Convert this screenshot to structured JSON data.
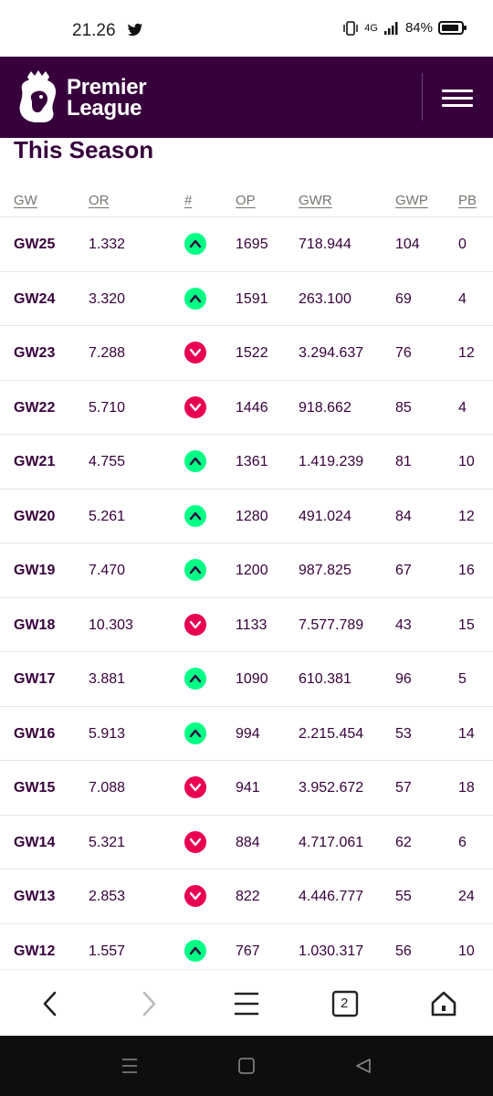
{
  "status_bar": {
    "time": "21.26",
    "network": "4G",
    "battery": "84%",
    "battery_level": 0.84
  },
  "header": {
    "brand_line1": "Premier",
    "brand_line2": "League",
    "menu_icon": "hamburger-icon"
  },
  "section": {
    "title": "This Season"
  },
  "table": {
    "columns": [
      "GW",
      "OR",
      "#",
      "OP",
      "GWR",
      "GWP",
      "PB"
    ],
    "rows": [
      {
        "gw": "GW25",
        "or": "1.332",
        "dir": "up",
        "op": "1695",
        "gwr": "718.944",
        "gwp": "104",
        "pb": "0"
      },
      {
        "gw": "GW24",
        "or": "3.320",
        "dir": "up",
        "op": "1591",
        "gwr": "263.100",
        "gwp": "69",
        "pb": "4"
      },
      {
        "gw": "GW23",
        "or": "7.288",
        "dir": "down",
        "op": "1522",
        "gwr": "3.294.637",
        "gwp": "76",
        "pb": "12"
      },
      {
        "gw": "GW22",
        "or": "5.710",
        "dir": "down",
        "op": "1446",
        "gwr": "918.662",
        "gwp": "85",
        "pb": "4"
      },
      {
        "gw": "GW21",
        "or": "4.755",
        "dir": "up",
        "op": "1361",
        "gwr": "1.419.239",
        "gwp": "81",
        "pb": "10"
      },
      {
        "gw": "GW20",
        "or": "5.261",
        "dir": "up",
        "op": "1280",
        "gwr": "491.024",
        "gwp": "84",
        "pb": "12"
      },
      {
        "gw": "GW19",
        "or": "7.470",
        "dir": "up",
        "op": "1200",
        "gwr": "987.825",
        "gwp": "67",
        "pb": "16"
      },
      {
        "gw": "GW18",
        "or": "10.303",
        "dir": "down",
        "op": "1133",
        "gwr": "7.577.789",
        "gwp": "43",
        "pb": "15"
      },
      {
        "gw": "GW17",
        "or": "3.881",
        "dir": "up",
        "op": "1090",
        "gwr": "610.381",
        "gwp": "96",
        "pb": "5"
      },
      {
        "gw": "GW16",
        "or": "5.913",
        "dir": "up",
        "op": "994",
        "gwr": "2.215.454",
        "gwp": "53",
        "pb": "14"
      },
      {
        "gw": "GW15",
        "or": "7.088",
        "dir": "down",
        "op": "941",
        "gwr": "3.952.672",
        "gwp": "57",
        "pb": "18"
      },
      {
        "gw": "GW14",
        "or": "5.321",
        "dir": "down",
        "op": "884",
        "gwr": "4.717.061",
        "gwp": "62",
        "pb": "6"
      },
      {
        "gw": "GW13",
        "or": "2.853",
        "dir": "down",
        "op": "822",
        "gwr": "4.446.777",
        "gwp": "55",
        "pb": "24"
      },
      {
        "gw": "GW12",
        "or": "1.557",
        "dir": "up",
        "op": "767",
        "gwr": "1.030.317",
        "gwp": "56",
        "pb": "10"
      }
    ]
  },
  "colors": {
    "brand_purple": "#37003c",
    "up_green": "#00ff85",
    "down_pink": "#e90052"
  },
  "browser_nav": {
    "items": [
      "back-icon",
      "forward-icon",
      "menu-icon",
      "tabs-icon",
      "home-icon"
    ],
    "tab_count": "2"
  },
  "system_nav": {
    "items": [
      "recents-icon",
      "home-button-icon",
      "back-triangle-icon"
    ]
  }
}
